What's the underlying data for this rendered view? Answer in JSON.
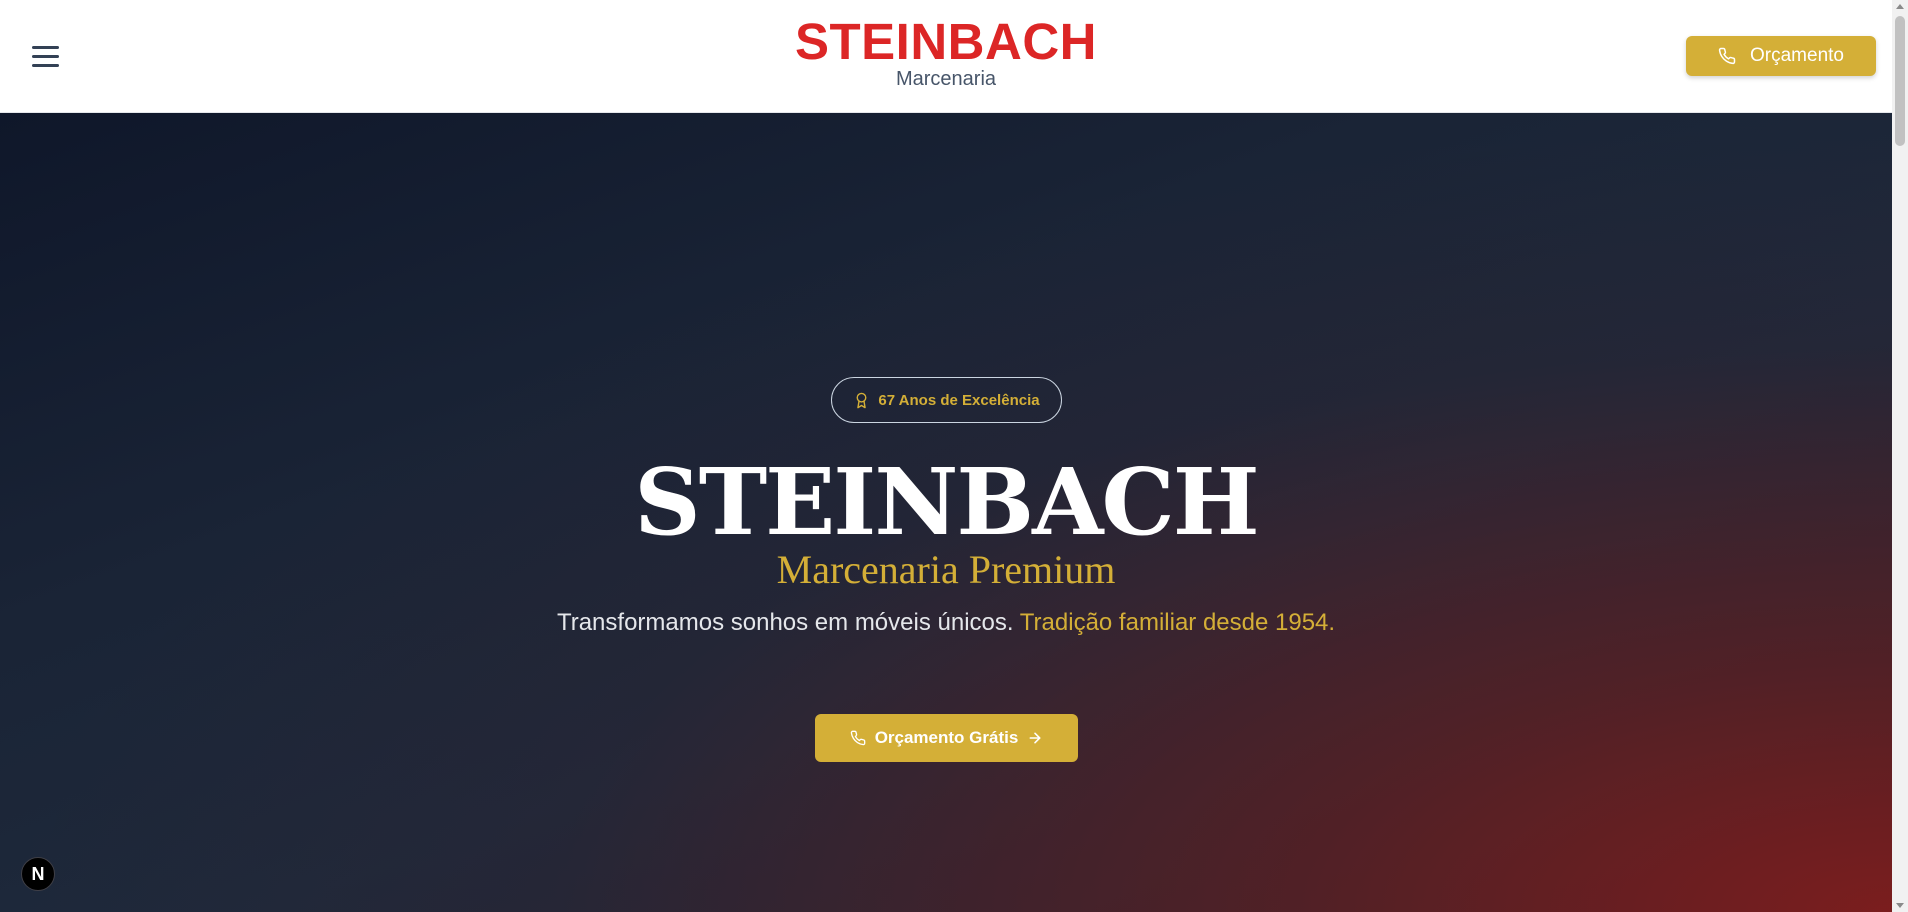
{
  "header": {
    "menu_icon": "hamburger-menu-icon",
    "brand_title": "STEINBACH",
    "brand_subtitle": "Marcenaria",
    "cta_label": "Orçamento",
    "cta_icon": "phone-icon"
  },
  "hero": {
    "badge_label": "67 Anos de Excelência",
    "badge_icon": "award-icon",
    "title": "STEINBACH",
    "subtitle": "Marcenaria Premium",
    "description": "Transformamos sonhos em móveis únicos.",
    "description_highlight": "Tradição familiar desde 1954.",
    "cta_label": "Orçamento Grátis",
    "cta_icons": [
      "phone-icon",
      "arrow-right-icon"
    ]
  },
  "dev_badge": {
    "label": "N",
    "icon": "nextjs-logo-icon"
  },
  "colors": {
    "brand_red": "#dc2626",
    "gold": "#d4af37",
    "dark_navy": "#0f172a",
    "text_slate": "#475569",
    "hero_text": "#e5e7eb"
  }
}
